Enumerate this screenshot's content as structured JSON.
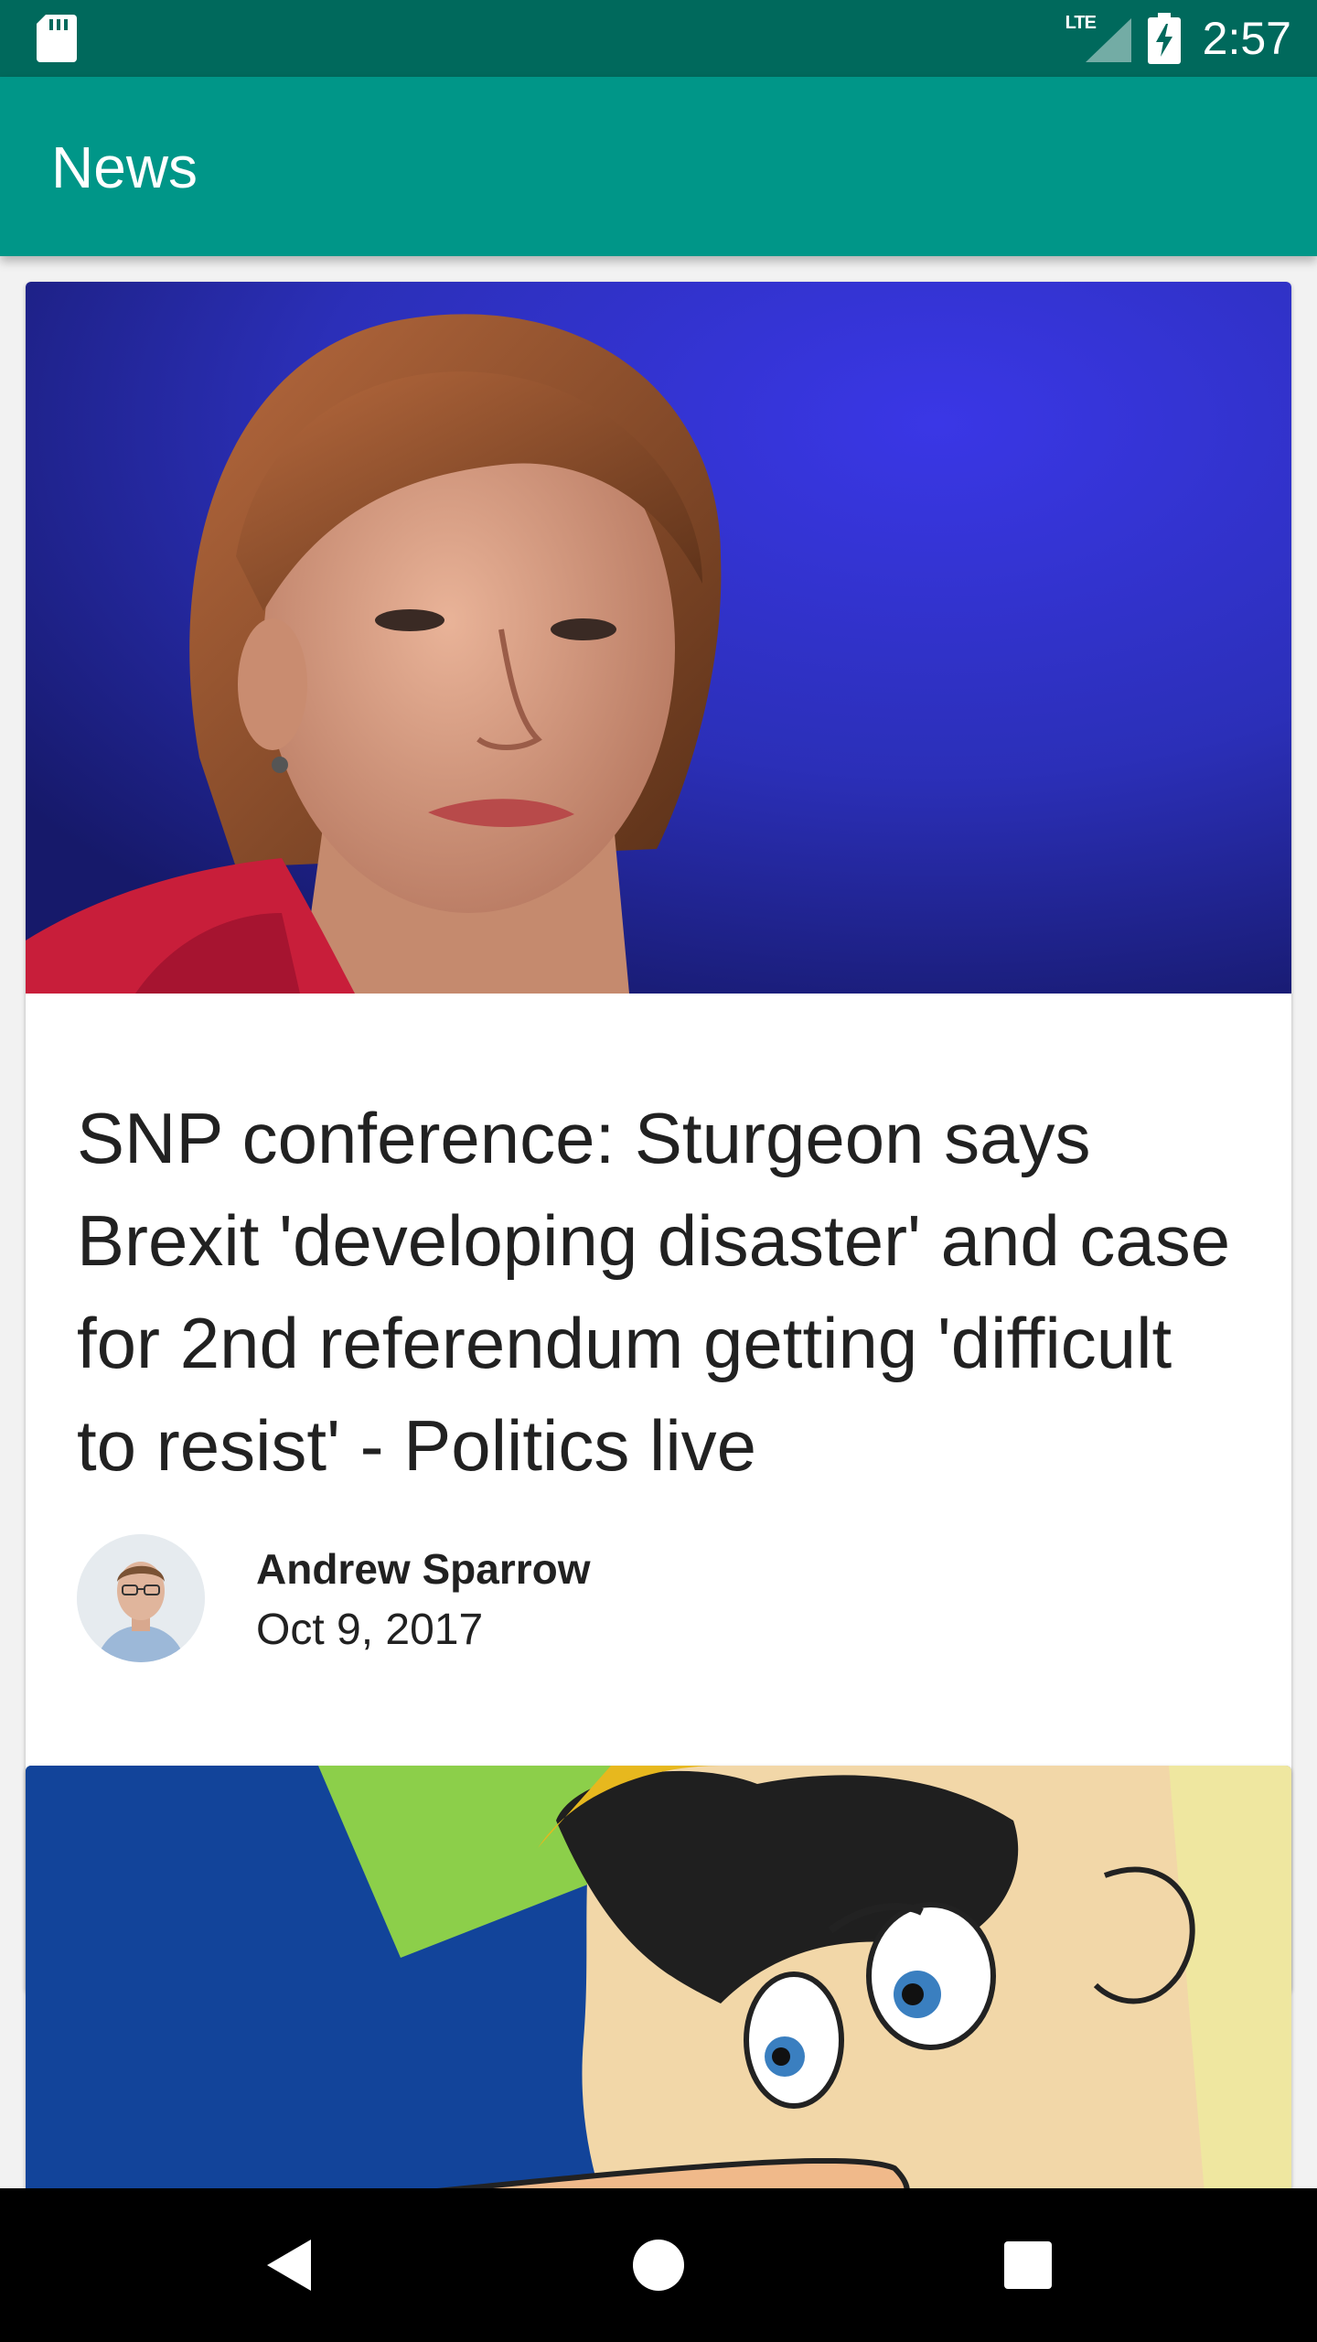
{
  "status_bar": {
    "left_icon": "sd-card-icon",
    "network_label": "LTE",
    "signal_icon": "signal-icon",
    "battery_icon": "battery-charging-icon",
    "time": "2:57"
  },
  "app_bar": {
    "title": "News"
  },
  "articles": [
    {
      "image": "article-photo",
      "title": "SNP conference: Sturgeon says Brexit 'developing disaster' and case for 2nd referendum getting 'difficult to resist' - Politics live",
      "author": "Andrew Sparrow",
      "date": "Oct 9, 2017"
    },
    {
      "image": "article-illustration"
    }
  ],
  "nav_bar": {
    "back_icon": "back-icon",
    "home_icon": "home-icon",
    "recents_icon": "recents-icon"
  },
  "colors": {
    "status_bar": "#00695c",
    "app_bar": "#009688",
    "background": "#f2f2f2",
    "card": "#ffffff",
    "text": "#212121",
    "nav_bar": "#000000"
  }
}
